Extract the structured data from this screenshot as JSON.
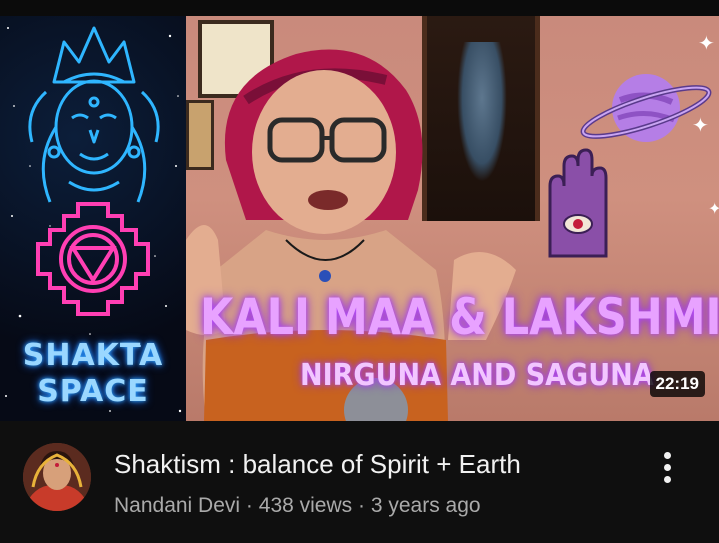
{
  "thumbnail": {
    "brand_line1": "SHAKTA",
    "brand_line2": "SPACE",
    "title_main": "KALI MAA & LAKSHMI",
    "title_sub": "NIRGUNA AND SAGUNA",
    "duration": "22:19"
  },
  "video": {
    "title": "Shaktism : balance of Spirit + Earth",
    "channel": "Nandani Devi",
    "separator": "·",
    "views": "438 views",
    "age": "3 years ago"
  },
  "icons": {
    "menu": "more-vert-icon"
  },
  "colors": {
    "background": "#0f0f0f",
    "title_text": "#f1f1f1",
    "secondary_text": "#aaaaaa",
    "neon_blue": "#9ad7ff",
    "neon_purple": "#e8a2ff",
    "yantra_pink": "#ff3fb3"
  }
}
